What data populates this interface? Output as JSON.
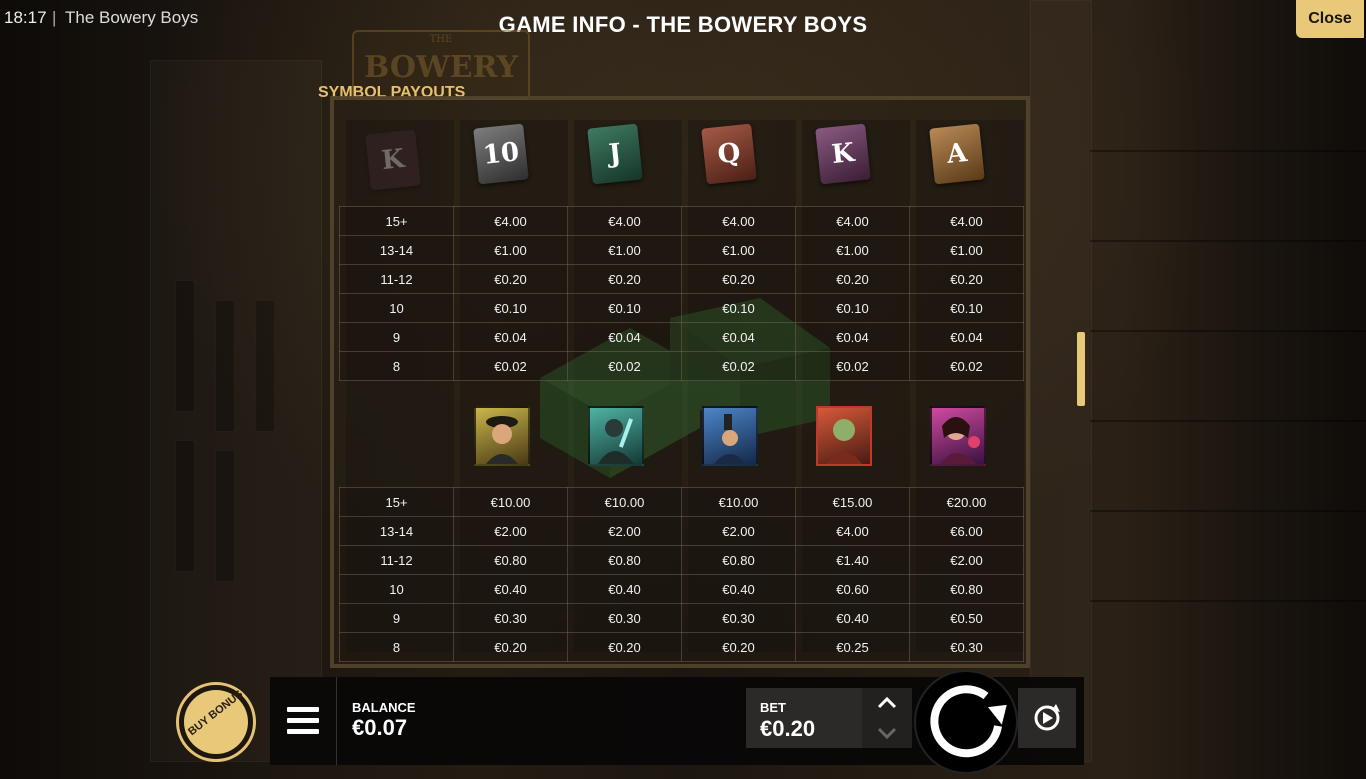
{
  "status_bar": {
    "time": "18:17",
    "separator": "|",
    "app_title": "The Bowery Boys"
  },
  "header": {
    "title": "GAME INFO - THE BOWERY BOYS",
    "close_label": "Close"
  },
  "logo_text": {
    "top": "THE",
    "main": "BOWERY"
  },
  "section": {
    "title": "SYMBOL PAYOUTS"
  },
  "payout_tables": [
    {
      "symbols": [
        {
          "name": "K",
          "label": "K"
        },
        {
          "name": "10",
          "label": "10"
        },
        {
          "name": "J",
          "label": "J"
        },
        {
          "name": "Q",
          "label": "Q"
        },
        {
          "name": "K",
          "label": "K"
        },
        {
          "name": "A",
          "label": "A"
        }
      ],
      "rows": [
        {
          "count": "15+",
          "values": [
            "€4.00",
            "€4.00",
            "€4.00",
            "€4.00",
            "€4.00"
          ]
        },
        {
          "count": "13-14",
          "values": [
            "€1.00",
            "€1.00",
            "€1.00",
            "€1.00",
            "€1.00"
          ]
        },
        {
          "count": "11-12",
          "values": [
            "€0.20",
            "€0.20",
            "€0.20",
            "€0.20",
            "€0.20"
          ]
        },
        {
          "count": "10",
          "values": [
            "€0.10",
            "€0.10",
            "€0.10",
            "€0.10",
            "€0.10"
          ]
        },
        {
          "count": "9",
          "values": [
            "€0.04",
            "€0.04",
            "€0.04",
            "€0.04",
            "€0.04"
          ]
        },
        {
          "count": "8",
          "values": [
            "€0.02",
            "€0.02",
            "€0.02",
            "€0.02",
            "€0.02"
          ]
        }
      ]
    },
    {
      "symbols": [
        {
          "name": "gangster-yellow"
        },
        {
          "name": "gangster-teal"
        },
        {
          "name": "gangster-blue"
        },
        {
          "name": "gangster-red"
        },
        {
          "name": "lady-pink"
        }
      ],
      "rows": [
        {
          "count": "15+",
          "values": [
            "€10.00",
            "€10.00",
            "€10.00",
            "€15.00",
            "€20.00"
          ]
        },
        {
          "count": "13-14",
          "values": [
            "€2.00",
            "€2.00",
            "€2.00",
            "€4.00",
            "€6.00"
          ]
        },
        {
          "count": "11-12",
          "values": [
            "€0.80",
            "€0.80",
            "€0.80",
            "€1.40",
            "€2.00"
          ]
        },
        {
          "count": "10",
          "values": [
            "€0.40",
            "€0.40",
            "€0.40",
            "€0.60",
            "€0.80"
          ]
        },
        {
          "count": "9",
          "values": [
            "€0.30",
            "€0.30",
            "€0.30",
            "€0.40",
            "€0.50"
          ]
        },
        {
          "count": "8",
          "values": [
            "€0.20",
            "€0.20",
            "€0.20",
            "€0.25",
            "€0.30"
          ]
        }
      ]
    }
  ],
  "controls": {
    "buy_bonus_label": "BUY BONUS",
    "menu_icon": "hamburger-icon",
    "balance_label": "BALANCE",
    "balance_value": "€0.07",
    "bet_label": "BET",
    "bet_value": "€0.20",
    "bet_up_icon": "chevron-up-icon",
    "bet_down_icon": "chevron-down-icon",
    "spin_icon": "spin-arrow-icon",
    "autoplay_icon": "autoplay-icon"
  },
  "colors": {
    "accent": "#e8c97a",
    "section_title": "#e7c06b",
    "text": "#ffffff"
  }
}
